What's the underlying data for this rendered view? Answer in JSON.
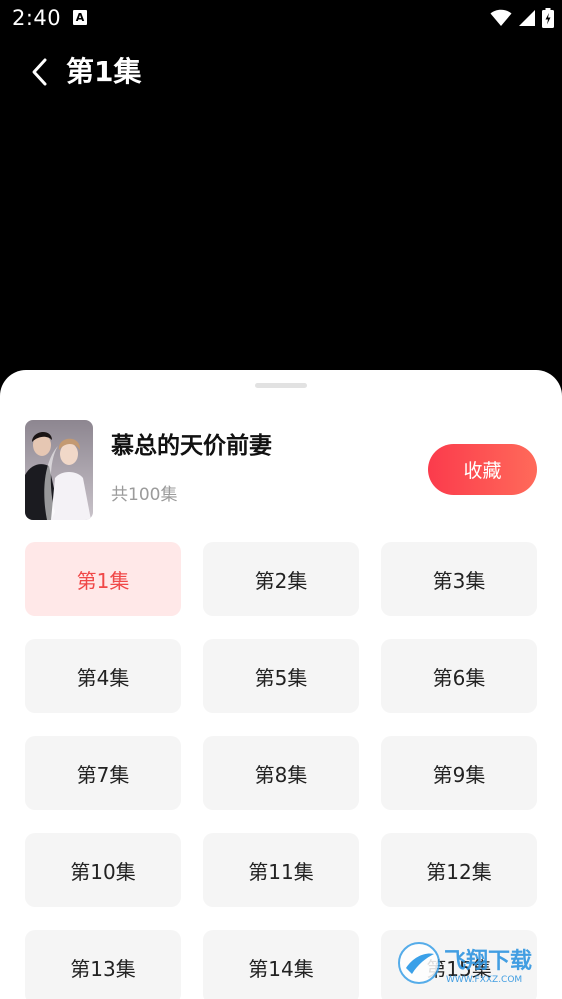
{
  "status_bar": {
    "time": "2:40",
    "notification_letter": "A"
  },
  "header": {
    "back_icon": "chevron-left-icon",
    "title": "第1集"
  },
  "drama": {
    "title": "慕总的天价前妻",
    "episode_count": "共100集",
    "collect_label": "收藏",
    "accent_color": "#fb3b4c"
  },
  "episodes": [
    "第1集",
    "第2集",
    "第3集",
    "第4集",
    "第5集",
    "第6集",
    "第7集",
    "第8集",
    "第9集",
    "第10集",
    "第11集",
    "第12集",
    "第13集",
    "第14集",
    "第15集"
  ],
  "active_episode": "第1集",
  "watermark": {
    "text": "飞翔下载",
    "url_text": "WWW.FXXZ.COM"
  }
}
